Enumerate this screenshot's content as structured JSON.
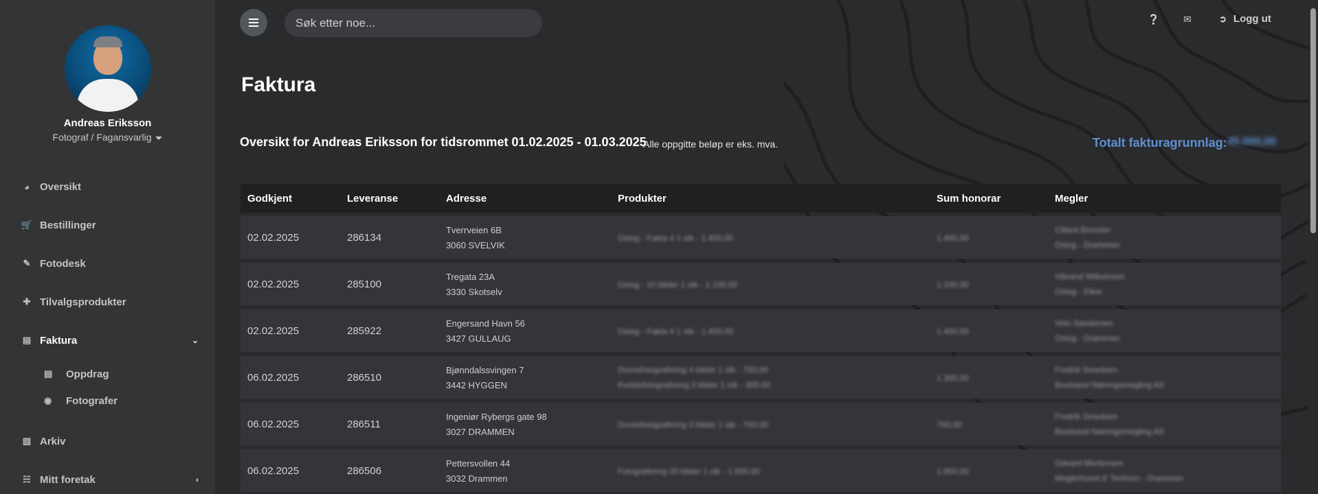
{
  "user": {
    "name": "Andreas Eriksson",
    "role": "Fotograf / Fagansvarlig"
  },
  "nav": {
    "items": [
      {
        "label": "Oversikt",
        "icon": "dashboard-icon"
      },
      {
        "label": "Bestillinger",
        "icon": "cart-icon"
      },
      {
        "label": "Fotodesk",
        "icon": "brush-icon"
      },
      {
        "label": "Tilvalgsprodukter",
        "icon": "plus-icon"
      },
      {
        "label": "Faktura",
        "icon": "credit-card-icon"
      },
      {
        "label": "Arkiv",
        "icon": "archive-icon"
      },
      {
        "label": "Mitt foretak",
        "icon": "sitemap-icon"
      }
    ],
    "sub_items": [
      {
        "label": "Oppdrag",
        "icon": "credit-card-icon"
      },
      {
        "label": "Fotografer",
        "icon": "camera-icon"
      }
    ]
  },
  "topbar": {
    "search_placeholder": "Søk etter noe...",
    "logout_label": "Logg ut"
  },
  "page": {
    "title": "Faktura",
    "overview": "Oversikt for Andreas Eriksson for tidsrommet 01.02.2025 - 01.03.2025",
    "vat_note": "Alle oppgitte beløp er eks. mva.",
    "total_label": "Totalt fakturagrunnlag:",
    "total_value": "45.000,00"
  },
  "table": {
    "headers": [
      "Godkjent",
      "Leveranse",
      "Adresse",
      "Produkter",
      "Sum honorar",
      "Megler"
    ],
    "rows": [
      {
        "approved": "02.02.2025",
        "delivery": "286134",
        "address1": "Tverrveien 6B",
        "address2": "3060 SVELVIK",
        "product1": "Oslog - Fakta 4 1 stk - 1.400,00",
        "product2": "",
        "sum": "1.400,00",
        "broker1": "Cillard Bressler",
        "broker2": "Oslog - Drammen"
      },
      {
        "approved": "02.02.2025",
        "delivery": "285100",
        "address1": "Tregata 23A",
        "address2": "3330 Skotselv",
        "product1": "Oslog - 10 bilder 1 stk - 1.100,00",
        "product2": "",
        "sum": "1.100,00",
        "broker1": "Vibrand Wilkelsson",
        "broker2": "Oslog - Eiker"
      },
      {
        "approved": "02.02.2025",
        "delivery": "285922",
        "address1": "Engersand Havn 56",
        "address2": "3427 GULLAUG",
        "product1": "Oslog - Fakta 4 1 stk - 1.400,00",
        "product2": "",
        "sum": "1.400,00",
        "broker1": "Vein Sandersen",
        "broker2": "Oslog - Drammen"
      },
      {
        "approved": "06.02.2025",
        "delivery": "286510",
        "address1": "Bjønndalssvingen 7",
        "address2": "3442 HYGGEN",
        "product1": "Dronefotografering 4 bilder 1 stk - 700,00",
        "product2": "Kveldsfotografering 3 bilder 1 stk - 300,00",
        "sum": "1.300,00",
        "broker1": "Fredrik Smedsen",
        "broker2": "Boolsand Næringsmegling AS"
      },
      {
        "approved": "06.02.2025",
        "delivery": "286511",
        "address1": "Ingeniør Rybergs gate 98",
        "address2": "3027 DRAMMEN",
        "product1": "Dronefotografering 3 bilder 1 stk - 700,00",
        "product2": "",
        "sum": "700,00",
        "broker1": "Fredrik Smedsen",
        "broker2": "Boolsand Næringsmegling AS"
      },
      {
        "approved": "06.02.2025",
        "delivery": "286506",
        "address1": "Pettersvollen 44",
        "address2": "3032 Drammen",
        "product1": "Fotografering 20 bilder 1 stk - 1.900,00",
        "product2": "",
        "sum": "1.900,00",
        "broker1": "Odvard Mortensen",
        "broker2": "Meglerhuset E Tenhorn - Drammen"
      }
    ]
  }
}
